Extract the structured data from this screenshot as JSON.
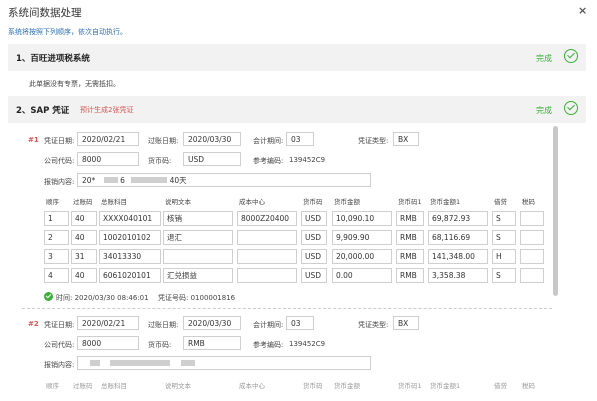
{
  "dialog": {
    "title": "系统间数据处理",
    "close": "×",
    "info": "系统将按照下列顺序，依次自动执行。"
  },
  "section1": {
    "title": "1、百旺进项税系统",
    "status": "完成",
    "note": "此单据没有专票，无需抵扣。"
  },
  "section2": {
    "title": "2、SAP 凭证",
    "subtitle": "预计生成2张凭证",
    "status": "完成"
  },
  "labels": {
    "doc_date": "凭证日期:",
    "post_date": "过账日期:",
    "period": "会计期间:",
    "doc_type": "凭证类型:",
    "company": "公司代码:",
    "currency": "货币码:",
    "ref": "参考编码:",
    "content": "报销内容:"
  },
  "columns": [
    "顺序",
    "过账码",
    "总账科目",
    "说明文本",
    "成本中心",
    "货币码",
    "货币金额",
    "货币码1",
    "货币金额1",
    "借贷",
    "税码"
  ],
  "voucher1": {
    "index": "#1",
    "doc_date": "2020/02/21",
    "post_date": "2020/03/30",
    "period": "03",
    "doc_type": "BX",
    "company": "8000",
    "currency": "USD",
    "ref": "139452C9",
    "content_a": "20*",
    "content_b": "6",
    "content_c": "40天",
    "rows": [
      {
        "seq": "1",
        "post": "40",
        "gl": "XXXX040101",
        "text": "核销",
        "cc": "8000Z20400",
        "cur": "USD",
        "amt": "10,090.10",
        "cur1": "RMB",
        "amt1": "69,872.93",
        "dc": "S",
        "tax": ""
      },
      {
        "seq": "2",
        "post": "40",
        "gl": "1002010102",
        "text": "退汇",
        "cc": "",
        "cur": "USD",
        "amt": "9,909.90",
        "cur1": "RMB",
        "amt1": "68,116.69",
        "dc": "S",
        "tax": ""
      },
      {
        "seq": "3",
        "post": "31",
        "gl": "34013330",
        "text": "",
        "cc": "",
        "cur": "USD",
        "amt": "20,000.00",
        "cur1": "RMB",
        "amt1": "141,348.00",
        "dc": "H",
        "tax": ""
      },
      {
        "seq": "4",
        "post": "40",
        "gl": "6061020101",
        "text": "汇兑损益",
        "cc": "",
        "cur": "USD",
        "amt": "0.00",
        "cur1": "RMB",
        "amt1": "3,358.38",
        "dc": "S",
        "tax": ""
      }
    ],
    "time": "时间: 2020/03/30 08:46:01",
    "voucher_no": "凭证号码: 0100001816"
  },
  "voucher2": {
    "index": "#2",
    "doc_date": "2020/02/21",
    "post_date": "2020/03/30",
    "period": "03",
    "doc_type": "BX",
    "company": "8000",
    "currency": "RMB",
    "ref": "139452C9"
  }
}
